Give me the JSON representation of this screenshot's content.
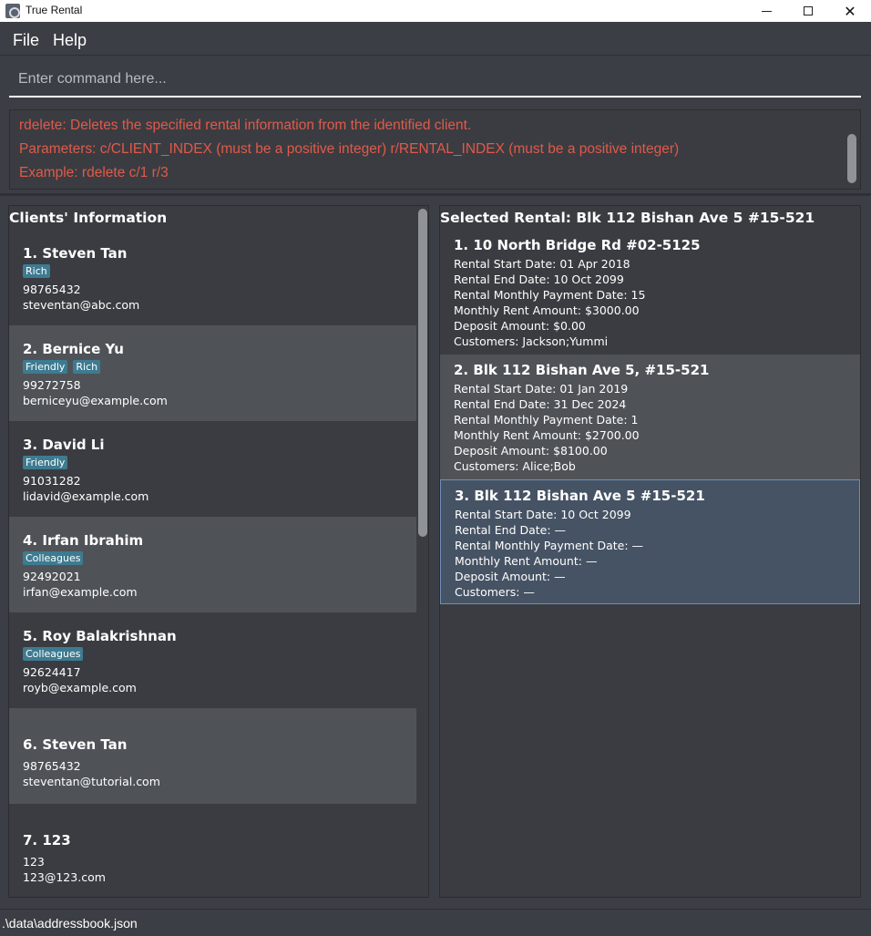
{
  "window": {
    "title": "True Rental"
  },
  "menu": {
    "file": "File",
    "help": "Help"
  },
  "command": {
    "placeholder": "Enter command here..."
  },
  "result": {
    "lines": [
      "rdelete: Deletes the specified rental information from the identified client.",
      "Parameters: c/CLIENT_INDEX (must be a positive integer) r/RENTAL_INDEX (must be a positive integer)",
      "Example: rdelete c/1 r/3"
    ],
    "color": "#e05a4a"
  },
  "clients": {
    "title": "Clients' Information",
    "items": [
      {
        "name": "1. Steven Tan",
        "tags": [
          "Rich"
        ],
        "phone": "98765432",
        "email": "steventan@abc.com"
      },
      {
        "name": "2. Bernice Yu",
        "tags": [
          "Friendly",
          "Rich"
        ],
        "phone": "99272758",
        "email": "berniceyu@example.com"
      },
      {
        "name": "3. David Li",
        "tags": [
          "Friendly"
        ],
        "phone": "91031282",
        "email": "lidavid@example.com"
      },
      {
        "name": "4. Irfan Ibrahim",
        "tags": [
          "Colleagues"
        ],
        "phone": "92492021",
        "email": "irfan@example.com"
      },
      {
        "name": "5. Roy Balakrishnan",
        "tags": [
          "Colleagues"
        ],
        "phone": "92624417",
        "email": "royb@example.com"
      },
      {
        "name": "6. Steven Tan",
        "tags": [],
        "phone": "98765432",
        "email": "steventan@tutorial.com"
      },
      {
        "name": "7. 123",
        "tags": [],
        "phone": "123",
        "email": "123@123.com"
      }
    ]
  },
  "rentals": {
    "title": "Selected Rental: Blk 112 Bishan Ave 5 #15-521",
    "items": [
      {
        "title": "1. 10 North Bridge Rd #02-5125",
        "start": "Rental Start Date: 01 Apr 2018",
        "end": "Rental End Date: 10 Oct 2099",
        "payment": "Rental Monthly Payment Date: 15",
        "rent": "Monthly Rent Amount: $3000.00",
        "deposit": "Deposit Amount: $0.00",
        "customers": "Customers: Jackson;Yummi"
      },
      {
        "title": "2. Blk 112 Bishan Ave 5, #15-521",
        "start": "Rental Start Date: 01 Jan 2019",
        "end": "Rental End Date: 31 Dec 2024",
        "payment": "Rental Monthly Payment Date: 1",
        "rent": "Monthly Rent Amount: $2700.00",
        "deposit": "Deposit Amount: $8100.00",
        "customers": "Customers: Alice;Bob"
      },
      {
        "title": "3. Blk 112 Bishan Ave 5 #15-521",
        "start": "Rental Start Date: 10 Oct 2099",
        "end": "Rental End Date: —",
        "payment": "Rental Monthly Payment Date: —",
        "rent": "Monthly Rent Amount: —",
        "deposit": "Deposit Amount: —",
        "customers": "Customers: —"
      }
    ],
    "selected_index": 2
  },
  "status": {
    "path": ".\\data\\addressbook.json"
  },
  "colors": {
    "background": "#3b3e44",
    "card_alt": "#4f5358",
    "tag": "#3e7b91",
    "selected": "#465364",
    "error_text": "#e05a4a"
  }
}
